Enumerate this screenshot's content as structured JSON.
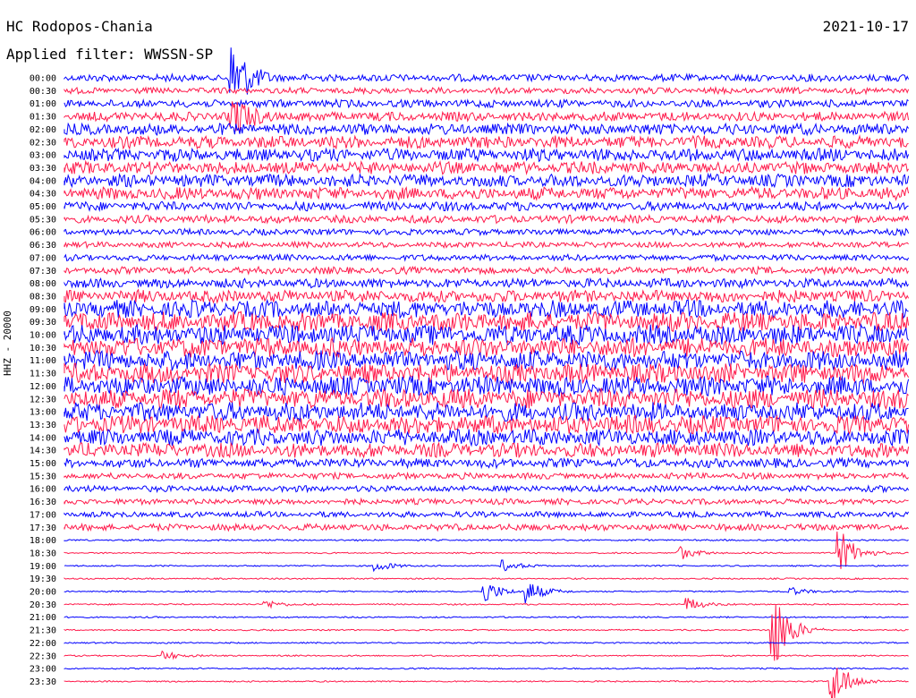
{
  "header": {
    "station": "HC Rodopos-Chania",
    "date": "2021-10-17",
    "filter": "Applied filter: WWSSN-SP"
  },
  "channel_label": "HHZ - 20000",
  "colors": {
    "even": "#0000ff",
    "odd": "#ff1a4b",
    "background": "#ffffff"
  },
  "chart_data": {
    "type": "line",
    "kind": "helicorder",
    "row_labels": [
      "00:00",
      "00:30",
      "01:00",
      "01:30",
      "02:00",
      "02:30",
      "03:00",
      "03:30",
      "04:00",
      "04:30",
      "05:00",
      "05:30",
      "06:00",
      "06:30",
      "07:00",
      "07:30",
      "08:00",
      "08:30",
      "09:00",
      "09:30",
      "10:00",
      "10:30",
      "11:00",
      "11:30",
      "12:00",
      "12:30",
      "13:00",
      "13:30",
      "14:00",
      "14:30",
      "15:00",
      "15:30",
      "16:00",
      "16:30",
      "17:00",
      "17:30",
      "18:00",
      "18:30",
      "19:00",
      "19:30",
      "20:00",
      "20:30",
      "21:00",
      "21:30",
      "22:00",
      "22:30",
      "23:00",
      "23:30"
    ],
    "noise_level": [
      0.35,
      0.3,
      0.38,
      0.45,
      0.55,
      0.6,
      0.62,
      0.6,
      0.62,
      0.6,
      0.45,
      0.38,
      0.3,
      0.28,
      0.3,
      0.35,
      0.45,
      0.6,
      0.85,
      0.95,
      0.95,
      0.95,
      0.95,
      0.95,
      0.95,
      0.95,
      0.9,
      0.9,
      0.8,
      0.7,
      0.45,
      0.3,
      0.3,
      0.28,
      0.28,
      0.32,
      0.08,
      0.07,
      0.07,
      0.07,
      0.07,
      0.07,
      0.07,
      0.07,
      0.07,
      0.07,
      0.07,
      0.07
    ],
    "events": [
      {
        "row": 0,
        "x_fraction": 0.2,
        "amplitude": 3.5
      },
      {
        "row": 3,
        "x_fraction": 0.2,
        "amplitude": 2.0
      },
      {
        "row": 37,
        "x_fraction": 0.73,
        "amplitude": 0.6
      },
      {
        "row": 37,
        "x_fraction": 0.92,
        "amplitude": 2.0
      },
      {
        "row": 38,
        "x_fraction": 0.37,
        "amplitude": 0.5
      },
      {
        "row": 38,
        "x_fraction": 0.52,
        "amplitude": 0.5
      },
      {
        "row": 40,
        "x_fraction": 0.5,
        "amplitude": 1.0
      },
      {
        "row": 40,
        "x_fraction": 0.55,
        "amplitude": 1.0
      },
      {
        "row": 40,
        "x_fraction": 0.86,
        "amplitude": 0.4
      },
      {
        "row": 41,
        "x_fraction": 0.24,
        "amplitude": 0.4
      },
      {
        "row": 41,
        "x_fraction": 0.74,
        "amplitude": 0.6
      },
      {
        "row": 43,
        "x_fraction": 0.84,
        "amplitude": 4.0
      },
      {
        "row": 45,
        "x_fraction": 0.12,
        "amplitude": 0.4
      },
      {
        "row": 47,
        "x_fraction": 0.91,
        "amplitude": 2.5
      }
    ],
    "grid": false
  }
}
